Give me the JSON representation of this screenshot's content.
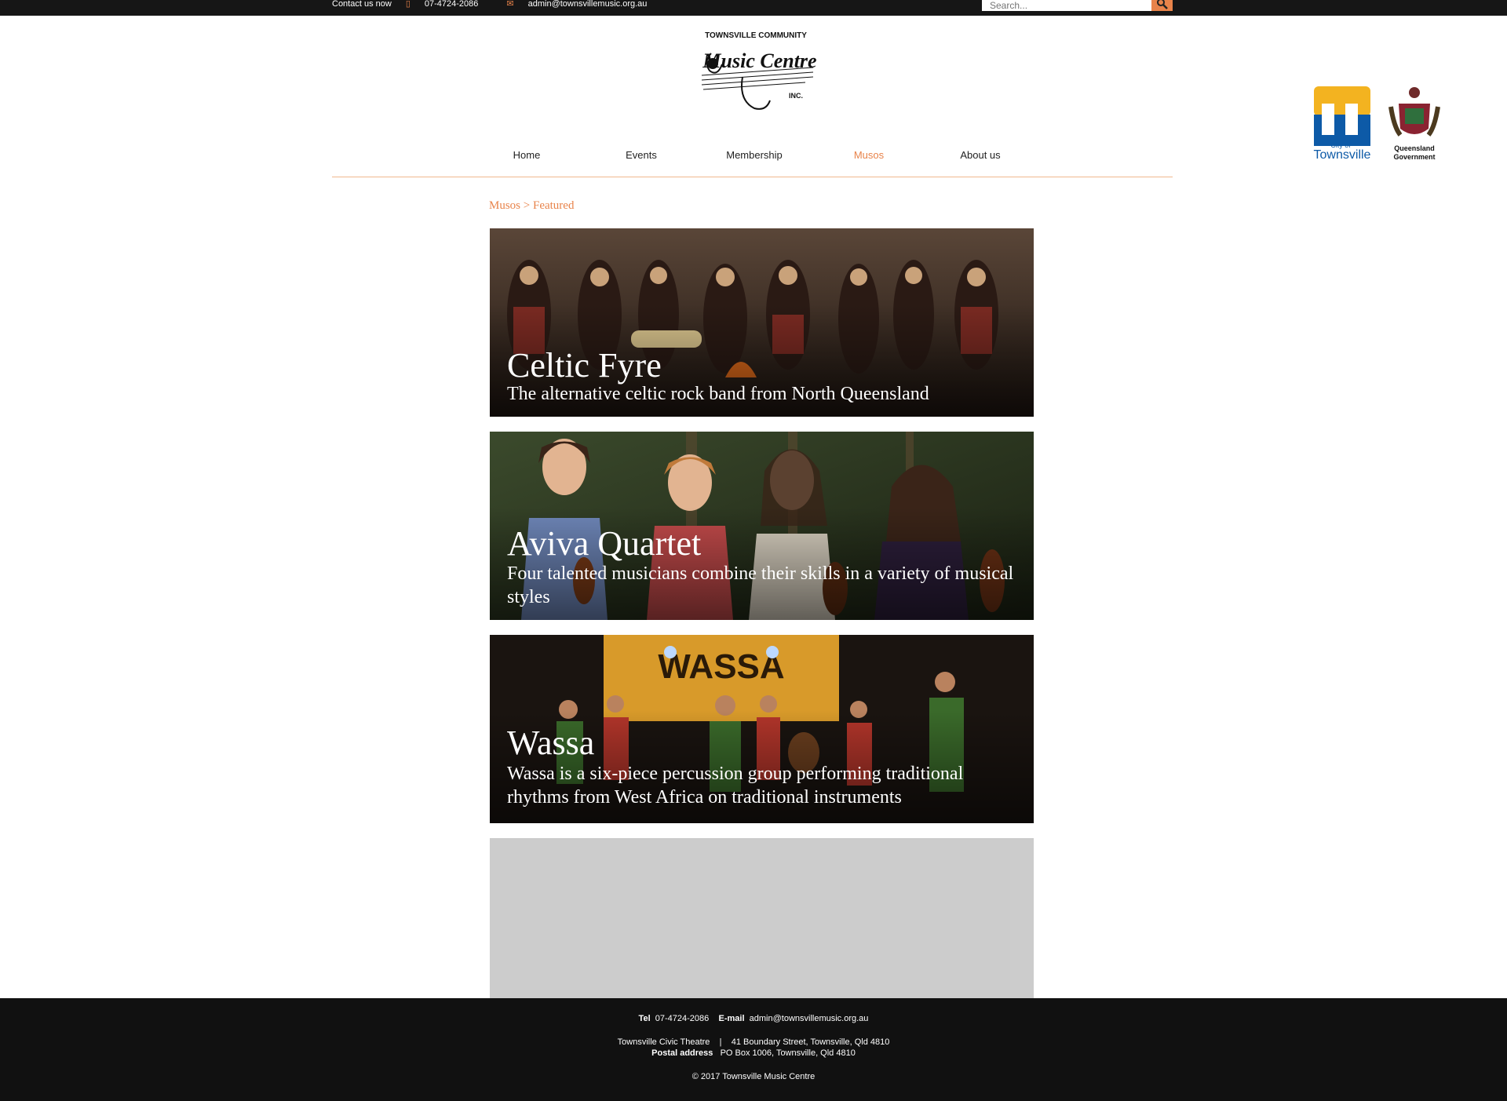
{
  "topbar": {
    "contact_label": "Contact us now",
    "phone": "07-4724-2086",
    "email": "admin@townsvillemusic.org.au",
    "search_placeholder": "Search..."
  },
  "logo": {
    "line1": "TOWNSVILLE COMMUNITY",
    "line2": "Music Centre",
    "line3": "INC."
  },
  "sponsors": {
    "city_small": "City of",
    "city_name": "Townsville",
    "qld_line1": "Queensland",
    "qld_line2": "Government"
  },
  "nav": [
    {
      "label": "Home"
    },
    {
      "label": "Events"
    },
    {
      "label": "Membership"
    },
    {
      "label": "Musos",
      "active": true
    },
    {
      "label": "About us"
    }
  ],
  "breadcrumb": "Musos > Featured",
  "cards": [
    {
      "title": "Celtic Fyre",
      "description": "The alternative celtic rock band from North Queensland"
    },
    {
      "title": "Aviva Quartet",
      "description": "Four talented musicians combine their skills in a variety of musical styles"
    },
    {
      "title": "Wassa",
      "description": "Wassa is a six-piece percussion group performing traditional rhythms from West Africa on traditional instruments"
    }
  ],
  "footer": {
    "tel_label": "Tel",
    "tel": "07-4724-2086",
    "email_label": "E-mail",
    "email": "admin@townsvillemusic.org.au",
    "venue": "Townsville Civic Theatre",
    "separator": "|",
    "street": "41 Boundary Street, Townsville, Qld 4810",
    "postal_label": "Postal address",
    "postal": "PO Box 1006, Townsville, Qld 4810",
    "copyright": "© 2017 Townsville Music Centre"
  },
  "colors": {
    "accent": "#e8834a",
    "topbar": "#161616",
    "footer": "#111111",
    "placeholder_card": "#cccccc"
  }
}
